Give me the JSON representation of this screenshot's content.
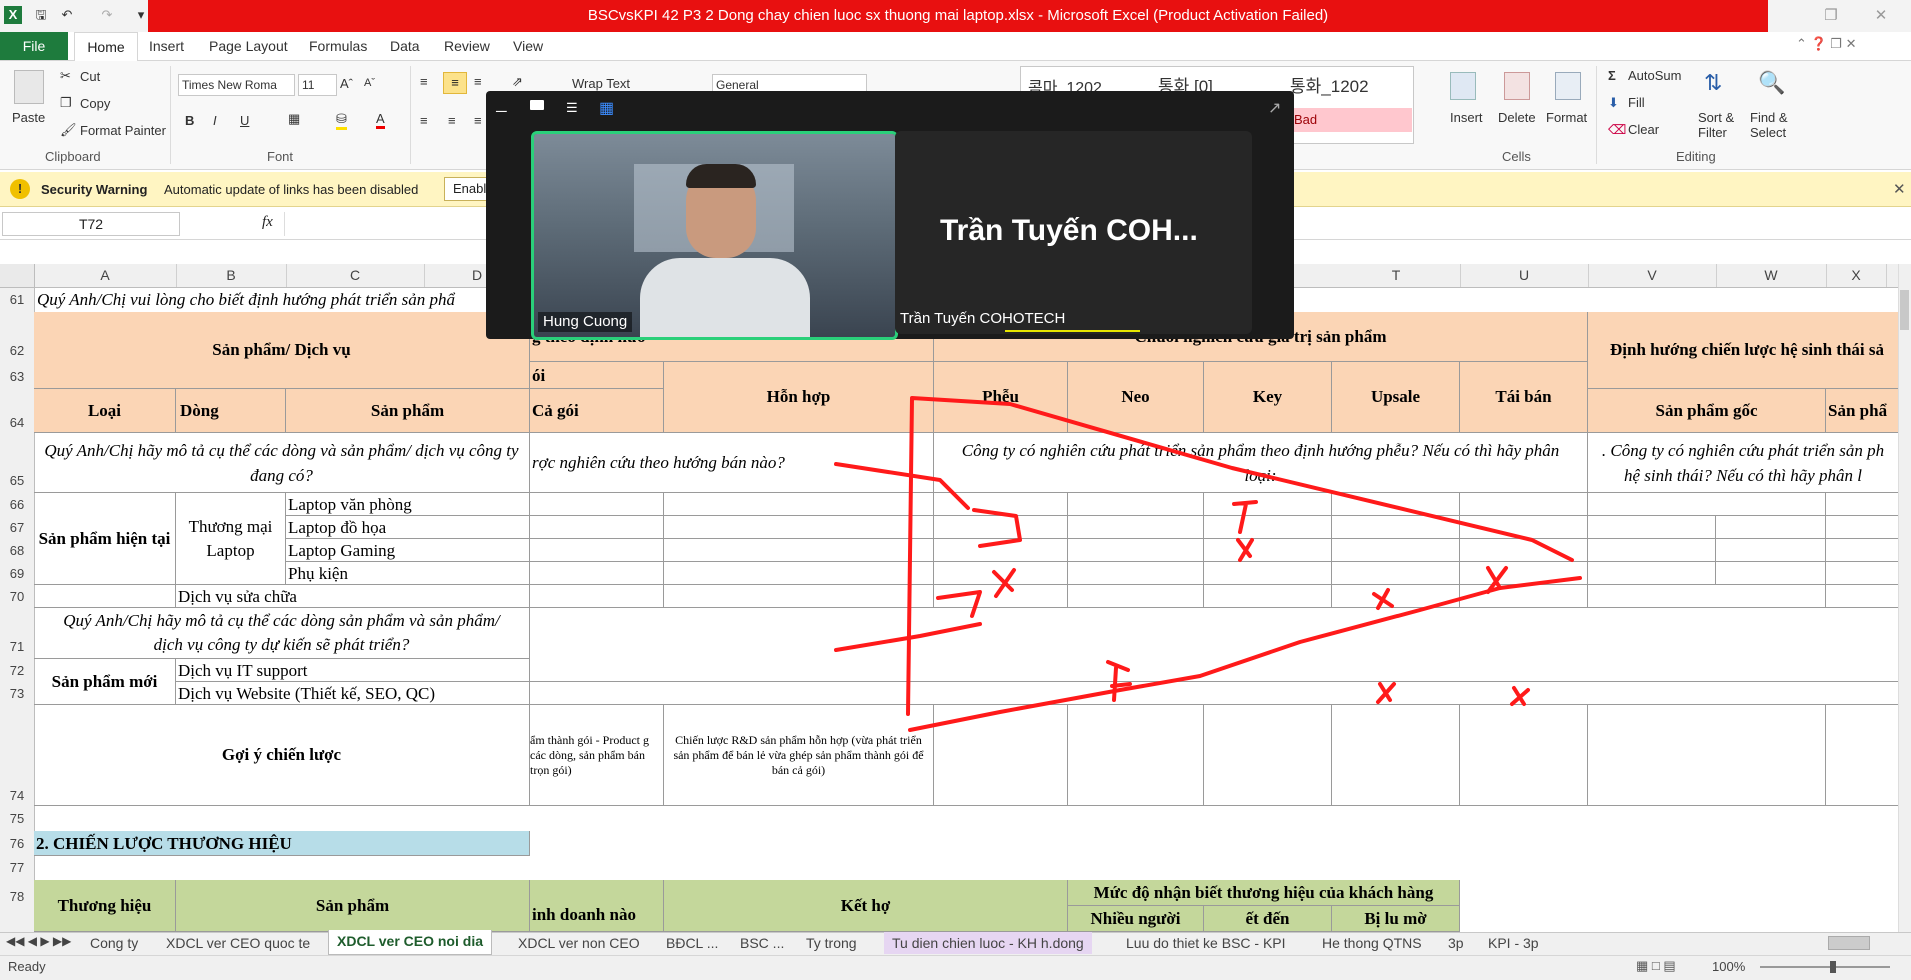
{
  "title": {
    "text": "BSCvsKPI 42 P3 2 Dong chay chien luoc sx thuong mai laptop.xlsx - Microsoft Excel (Product Activation Failed)"
  },
  "ribbon_tabs": [
    "File",
    "Home",
    "Insert",
    "Page Layout",
    "Formulas",
    "Data",
    "Review",
    "View"
  ],
  "clipboard": {
    "paste": "Paste",
    "cut": "Cut",
    "copy": "Copy",
    "format_painter": "Format Painter",
    "label": "Clipboard"
  },
  "font": {
    "name": "Times New Roma",
    "size": "11",
    "label": "Font",
    "bold": "B",
    "italic": "I",
    "underline": "U"
  },
  "alignment": {
    "wrap_text": "Wrap Text"
  },
  "number": {
    "format": "General"
  },
  "styles": {
    "style1": "콤마_1202",
    "style2": "통화 [0]",
    "style3": "통화_1202",
    "bad": "Bad"
  },
  "cells_group": {
    "insert": "Insert",
    "delete": "Delete",
    "format": "Format",
    "label": "Cells"
  },
  "editing": {
    "autosum": "AutoSum",
    "fill": "Fill",
    "clear": "Clear",
    "sort": "Sort &\nFilter",
    "find": "Find &\nSelect",
    "label": "Editing"
  },
  "security": {
    "title": "Security Warning",
    "message": "Automatic update of links has been disabled",
    "button": "Enabl"
  },
  "formula_bar": {
    "name_box": "T72",
    "fx": "fx"
  },
  "columns": [
    "A",
    "B",
    "C",
    "D",
    "T",
    "U",
    "V",
    "W",
    "X"
  ],
  "rows": [
    "61",
    "62",
    "63",
    "64",
    "65",
    "66",
    "67",
    "68",
    "69",
    "70",
    "71",
    "72",
    "73",
    "74",
    "75",
    "76",
    "77",
    "78"
  ],
  "sheet": {
    "r61": "Quý Anh/Chị vui lòng cho biết định hướng phát triển sản phẩ",
    "san_pham_dich_vu": "Sản phẩm/ Dịch vụ",
    "loai": "Loại",
    "dong": "Dòng",
    "san_pham": "Sản phẩm",
    "goi_top": "g theo định hướ",
    "goi": "ói",
    "ca_goi": "Cả gói",
    "hon_hop": "Hỗn hợp",
    "chuoi_gia_tri": "Chuỗi nghiên cứu giá trị sản phẩm",
    "pheu": "Phễu",
    "neo": "Neo",
    "key": "Key",
    "upsale": "Upsale",
    "tai_ban": "Tái bán",
    "dinh_huong_he_sinh_thai": "Định hướng chiến lược hệ sinh thái sả",
    "san_pham_goc": "Sản phẩm gốc",
    "san_pham_cut": "Sản phẩ",
    "r65_a": "Quý Anh/Chị hãy mô tả cụ thể các dòng và sản phẩm/ dịch vụ công ty đang có?",
    "r65_mid": "rợc nghiên cứu theo hướng bán nào?",
    "r65_pheu": "Công ty có nghiên cứu phát triển sản phẩm theo định hướng phễu? Nếu có thì hãy phân loại:",
    "r65_right": ". Công ty có nghiên cứu phát triển sản ph hệ sinh thái? Nếu có thì hãy phân l",
    "sp_hien_tai": "Sản phẩm hiện tại",
    "thuong_mai_laptop": "Thương mại Laptop",
    "laptop_van_phong": "Laptop văn phòng",
    "laptop_do_hoa": "Laptop đồ họa",
    "laptop_gaming": "Laptop Gaming",
    "phu_kien": "Phụ kiện",
    "dich_vu_sua_chua": "Dịch vụ sửa chữa",
    "r71": "Quý Anh/Chị hãy mô tả cụ thể các dòng sản phẩm và sản phẩm/ dịch vụ công ty dự kiến sẽ phát triển?",
    "sp_moi": "Sản phẩm mới",
    "dv_it": "Dịch vụ IT support",
    "dv_web": "Dịch vụ Website (Thiết kế, SEO, QC)",
    "goi_y": "Gợi ý chiến lược",
    "r74_goi": "ẩm thành gói - Product g các dòng, sản phẩm bán trọn gói)",
    "r74_hon_hop": "Chiến lược R&D sản phẩm hỗn hợp (vừa phát triển sản phẩm để bán lẻ vừa ghép sản phẩm thành gói để bán cả gói)",
    "r76": "2. CHIẾN LƯỢC THƯƠNG HIỆU",
    "thuong_hieu": "Thương hiệu",
    "san_pham_78": "Sản phẩm",
    "muc_do": "Mức độ nhận biết thương hiệu của khách hàng",
    "nhieu_nguoi": "Nhiều người",
    "ket_hop": "Kết hợ",
    "r79_a": "inh doanh nào",
    "r79_c": "ết đến",
    "r79_d": "Bị lu mờ"
  },
  "video": {
    "tile1_name": "Hung Cuong",
    "tile2_title": "Trần Tuyến COH...",
    "tile2_name": "Trần Tuyến COHOTECH"
  },
  "sheet_tabs": [
    "Cong ty",
    "XDCL ver CEO quoc te",
    "XDCL ver CEO noi dia",
    "XDCL ver non CEO",
    "BĐCL ...",
    "BSC ...",
    "Ty trong",
    "Tu dien chien luoc - KH h.dong",
    "Luu do thiet ke BSC - KPI",
    "He thong QTNS",
    "3p",
    "KPI - 3p"
  ],
  "status": {
    "ready": "Ready",
    "zoom": "100%"
  },
  "colors": {
    "excel_green": "#1e7b3d",
    "title_red": "#e81010",
    "peach": "#fbd5b5",
    "green": "#c4d79b",
    "blue": "#b7dde8",
    "annotation": "#ff1a1a",
    "video_border": "#2ad07a"
  }
}
